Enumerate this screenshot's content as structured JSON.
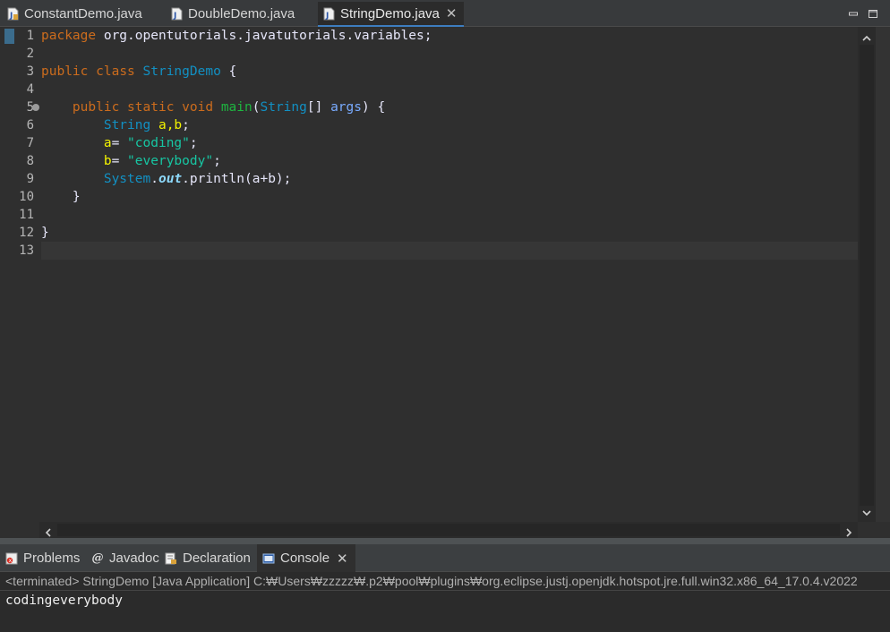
{
  "editor_tabs": [
    {
      "label": "ConstantDemo.java",
      "active": false
    },
    {
      "label": "DoubleDemo.java",
      "active": false
    },
    {
      "label": "StringDemo.java",
      "active": true,
      "close": "✕"
    }
  ],
  "code": {
    "line_numbers": [
      "1",
      "2",
      "3",
      "4",
      "5",
      "6",
      "7",
      "8",
      "9",
      "10",
      "11",
      "12",
      "13"
    ],
    "l1": {
      "kw": "package",
      "rest": " org.opentutorials.javatutorials.variables;"
    },
    "l3": {
      "kw1": "public",
      "kw2": "class",
      "cls": "StringDemo",
      "rest": " {"
    },
    "l5": {
      "kw1": "public",
      "kw2": "static",
      "kw3": "void",
      "fn": "main",
      "p1": "(",
      "type": "String",
      "p2": "[] ",
      "param": "args",
      "p3": ") {"
    },
    "l6": {
      "type": "String",
      "vars": "a,b",
      "end": ";"
    },
    "l7": {
      "var": "a",
      "eq": "= ",
      "str": "\"coding\"",
      "end": ";"
    },
    "l8": {
      "var": "b",
      "eq": "= ",
      "str": "\"everybody\"",
      "end": ";"
    },
    "l9": {
      "cls": "System",
      "dot1": ".",
      "fld": "out",
      "rest": ".println(a+b);"
    },
    "l10": {
      "text": "}"
    },
    "l12": {
      "text": "}"
    }
  },
  "bottom_tabs": [
    {
      "label": "Problems",
      "icon": "problems-icon"
    },
    {
      "label": "Javadoc",
      "icon": "javadoc-icon"
    },
    {
      "label": "Declaration",
      "icon": "declaration-icon"
    },
    {
      "label": "Console",
      "icon": "console-icon",
      "active": true,
      "close": "✕"
    }
  ],
  "console": {
    "header": "<terminated> StringDemo [Java Application] C:₩Users₩zzzzz₩.p2₩pool₩plugins₩org.eclipse.justj.openjdk.hotspot.jre.full.win32.x86_64_17.0.4.v2022",
    "output": "codingeverybody"
  },
  "colors": {
    "keyword": "#cc6c1d",
    "class": "#1290c3",
    "method": "#1eb540",
    "local_var": "#f2f200",
    "string": "#17c6a3",
    "static_field": "#8dd9fb",
    "active_tab_indicator": "#3d7dbf"
  }
}
